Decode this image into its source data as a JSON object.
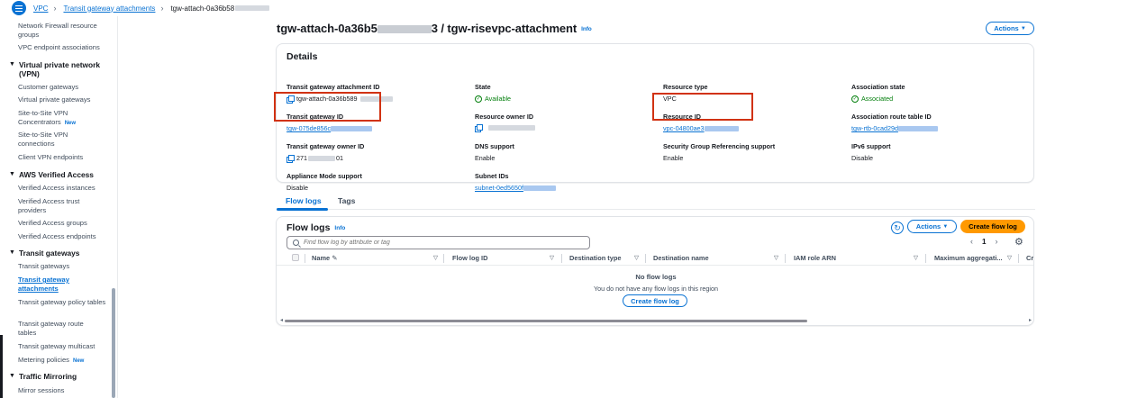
{
  "breadcrumb": {
    "items": [
      "VPC",
      "Transit gateway attachments",
      "tgw-attach-0a36b58"
    ]
  },
  "sidebar": {
    "items": [
      {
        "type": "item",
        "label": "Network Firewall resource groups"
      },
      {
        "type": "item",
        "label": "VPC endpoint associations"
      },
      {
        "type": "head",
        "label": "Virtual private network (VPN)"
      },
      {
        "type": "item",
        "label": "Customer gateways"
      },
      {
        "type": "item",
        "label": "Virtual private gateways"
      },
      {
        "type": "item",
        "label": "Site-to-Site VPN Concentrators",
        "badge": "New"
      },
      {
        "type": "item",
        "label": "Site-to-Site VPN connections"
      },
      {
        "type": "item",
        "label": "Client VPN endpoints"
      },
      {
        "type": "head",
        "label": "AWS Verified Access"
      },
      {
        "type": "item",
        "label": "Verified Access instances"
      },
      {
        "type": "item",
        "label": "Verified Access trust providers"
      },
      {
        "type": "item",
        "label": "Verified Access groups"
      },
      {
        "type": "item",
        "label": "Verified Access endpoints"
      },
      {
        "type": "head",
        "label": "Transit gateways"
      },
      {
        "type": "item",
        "label": "Transit gateways"
      },
      {
        "type": "item",
        "label": "Transit gateway attachments",
        "active": true
      },
      {
        "type": "item",
        "label": "Transit gateway policy tables"
      },
      {
        "type": "item",
        "label": "Transit gateway route tables"
      },
      {
        "type": "item",
        "label": "Transit gateway multicast"
      },
      {
        "type": "item",
        "label": "Metering policies",
        "badge": "New"
      },
      {
        "type": "head",
        "label": "Traffic Mirroring"
      },
      {
        "type": "item",
        "label": "Mirror sessions"
      }
    ]
  },
  "page": {
    "title_prefix": "tgw-attach-0a36b5",
    "title_suffix": "3 / tgw-risevpc-attachment",
    "info": "Info",
    "actions_label": "Actions"
  },
  "details": {
    "heading": "Details",
    "fields": {
      "attachment_id_label": "Transit gateway attachment ID",
      "attachment_id_value": "tgw-attach-0a36b589",
      "state_label": "State",
      "state_value": "Available",
      "resource_type_label": "Resource type",
      "resource_type_value": "VPC",
      "association_state_label": "Association state",
      "association_state_value": "Associated",
      "tgw_id_label": "Transit gateway ID",
      "tgw_id_value": "tgw-075de856c",
      "owner_id_label": "Resource owner ID",
      "resource_id_label": "Resource ID",
      "resource_id_value": "vpc-04800ae3",
      "route_table_label": "Association route table ID",
      "route_table_value": "tgw-rtb-0cad29d",
      "tgw_owner_label": "Transit gateway owner ID",
      "tgw_owner_prefix": "271",
      "tgw_owner_suffix": "01",
      "dns_label": "DNS support",
      "dns_value": "Enable",
      "sg_label": "Security Group Referencing support",
      "sg_value": "Enable",
      "ipv6_label": "IPv6 support",
      "ipv6_value": "Disable",
      "appliance_label": "Appliance Mode support",
      "appliance_value": "Disable",
      "subnet_label": "Subnet IDs",
      "subnet_value": "subnet-0ed5650f"
    }
  },
  "tabs": [
    "Flow logs",
    "Tags"
  ],
  "flow_logs": {
    "heading": "Flow logs",
    "info": "Info",
    "actions_label": "Actions",
    "create_label": "Create flow log",
    "search_placeholder": "Find flow log by attribute or tag",
    "page_number": "1",
    "columns": [
      "Name",
      "Flow log ID",
      "Destination type",
      "Destination name",
      "IAM role ARN",
      "Maximum aggregati...",
      "Cr"
    ],
    "empty_title": "No flow logs",
    "empty_subtitle": "You do not have any flow logs in this region",
    "empty_button": "Create flow log"
  },
  "colors": {
    "accent": "#0972d3",
    "primary_button": "#ff9900",
    "success": "#037f0c",
    "highlight_box": "#d13212"
  }
}
